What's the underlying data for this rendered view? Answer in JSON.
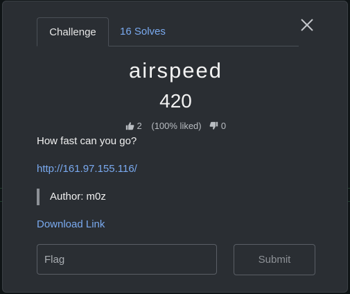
{
  "modal": {
    "tabs": [
      {
        "label": "Challenge",
        "active": true
      },
      {
        "label": "16 Solves",
        "active": false
      }
    ],
    "close_icon": "close-icon",
    "challenge": {
      "name": "airspeed",
      "points": "420",
      "likes": "2",
      "liked_percent": "(100% liked)",
      "dislikes": "0",
      "description": "How fast can you go?",
      "url": "http://161.97.155.116/",
      "author_quote": "Author: m0z",
      "download_label": "Download Link"
    },
    "flag_input": {
      "placeholder": "Flag",
      "value": ""
    },
    "submit_label": "Submit"
  },
  "colors": {
    "modal_background": "#2a2e33",
    "link": "#7aaaf0",
    "text": "#f0f0f0",
    "border": "#5a5f66"
  }
}
